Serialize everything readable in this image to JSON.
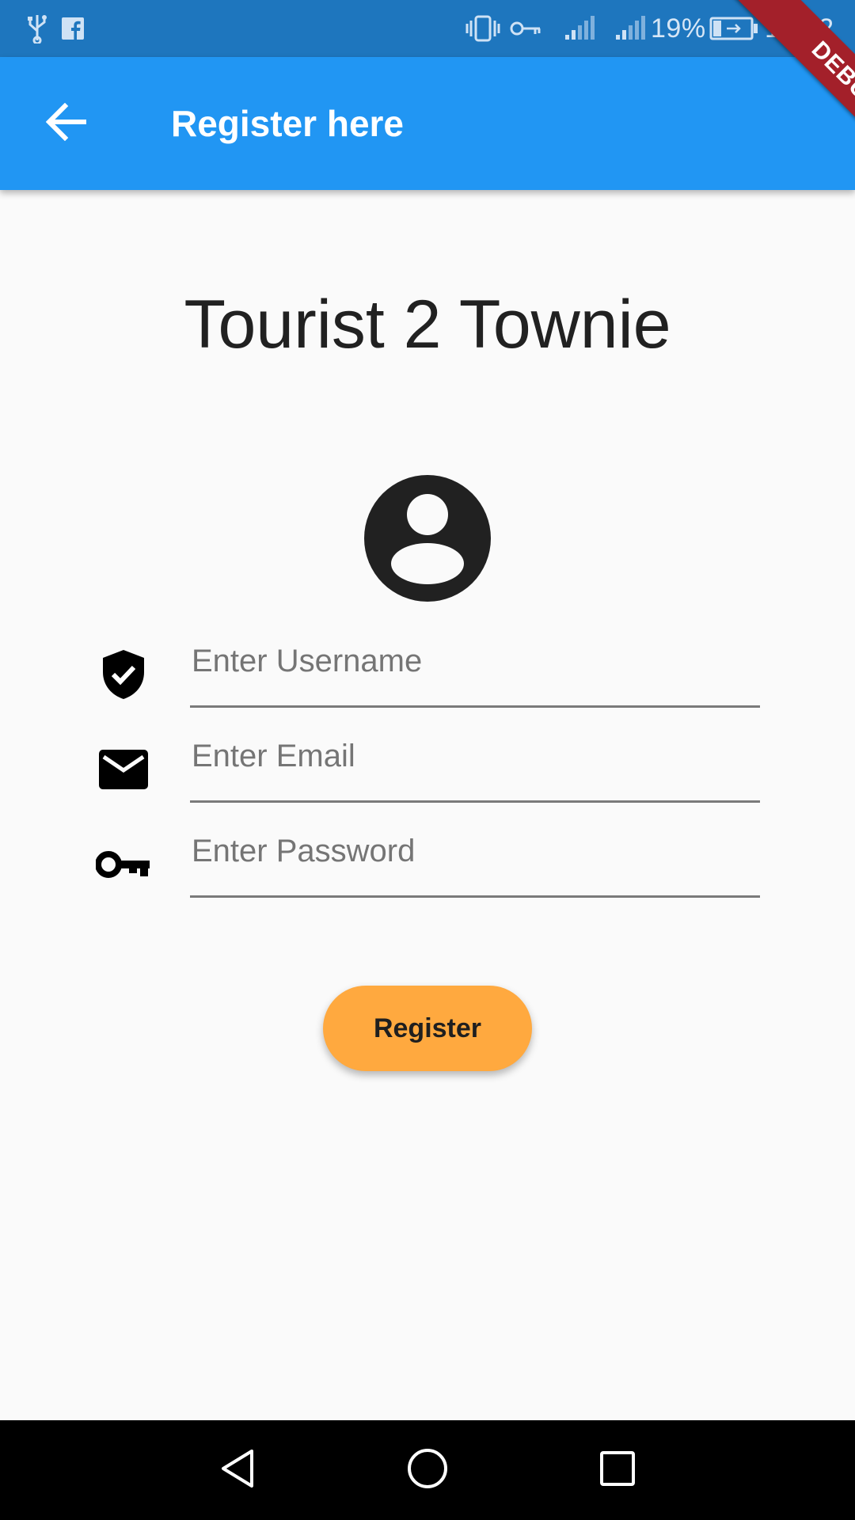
{
  "status_bar": {
    "battery_percent": "19%",
    "time": "19:42",
    "icons": [
      "usb-icon",
      "facebook-icon",
      "vibrate-icon",
      "vpn-key-icon",
      "signal-icon",
      "signal-icon",
      "battery-charging-icon"
    ]
  },
  "debug_banner": "DEBUG",
  "app_bar": {
    "title": "Register here",
    "back_icon": "arrow-back-icon",
    "color": "#2196f3"
  },
  "main": {
    "heading": "Tourist 2 Townie",
    "avatar_icon": "account-circle-icon",
    "fields": [
      {
        "icon": "verified-user-icon",
        "placeholder": "Enter Username",
        "value": ""
      },
      {
        "icon": "email-icon",
        "placeholder": "Enter Email",
        "value": ""
      },
      {
        "icon": "vpn-key-icon",
        "placeholder": "Enter Password",
        "value": ""
      }
    ],
    "register_label": "Register",
    "register_color": "#ffa93f"
  },
  "nav_bar": {
    "buttons": [
      "back-triangle-icon",
      "home-circle-icon",
      "recents-square-icon"
    ]
  }
}
